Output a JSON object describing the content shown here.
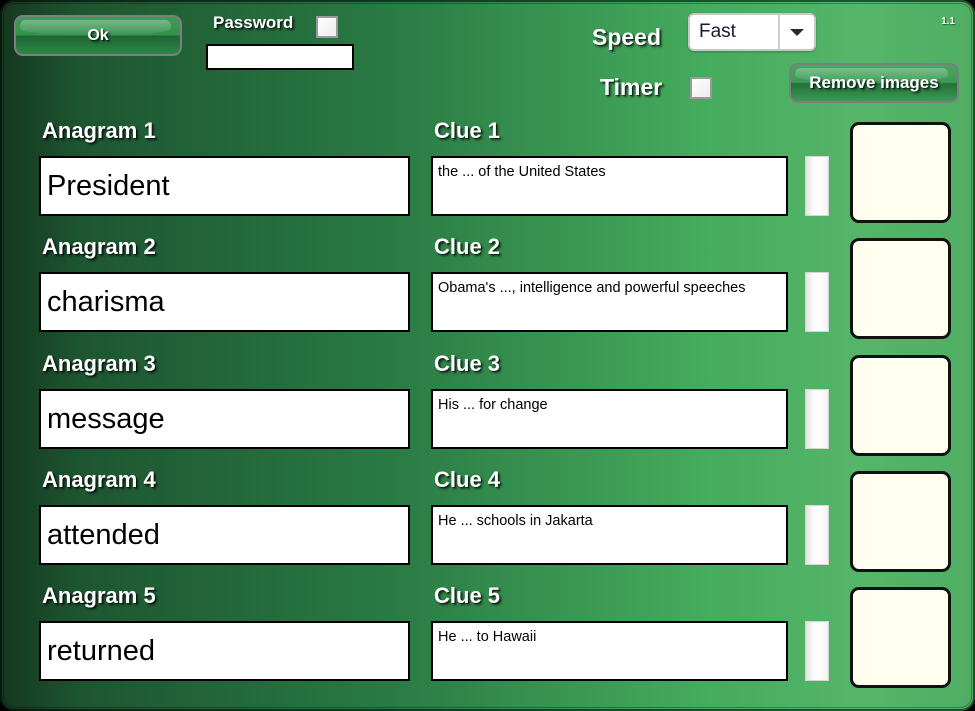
{
  "window": {
    "version": "1.1"
  },
  "toolbar": {
    "ok_label": "Ok",
    "password_label": "Password",
    "password_value": "",
    "password_placeholder": "",
    "speed_label": "Speed",
    "speed_value": "Fast",
    "speed_options": [
      "Fast"
    ],
    "timer_label": "Timer",
    "remove_images_label": "Remove images"
  },
  "rows": [
    {
      "anagram_label": "Anagram 1",
      "anagram_value": "President",
      "clue_label": "Clue 1",
      "clue_value": "the ... of the United States"
    },
    {
      "anagram_label": "Anagram 2",
      "anagram_value": "charisma",
      "clue_label": "Clue 2",
      "clue_value": "Obama's ..., intelligence and powerful speeches"
    },
    {
      "anagram_label": "Anagram 3",
      "anagram_value": "message",
      "clue_label": "Clue 3",
      "clue_value": "His ... for change"
    },
    {
      "anagram_label": "Anagram 4",
      "anagram_value": "attended",
      "clue_label": "Clue 4",
      "clue_value": "He ... schools in Jakarta"
    },
    {
      "anagram_label": "Anagram 5",
      "anagram_value": "returned",
      "clue_label": "Clue 5",
      "clue_value": "He ... to Hawaii"
    }
  ],
  "colors": {
    "background_dark_green": "#15361f",
    "background_light_green": "#55b569",
    "button_green": "#3f9a57",
    "image_box_ivory": "#fffff0",
    "field_border": "#000000"
  }
}
